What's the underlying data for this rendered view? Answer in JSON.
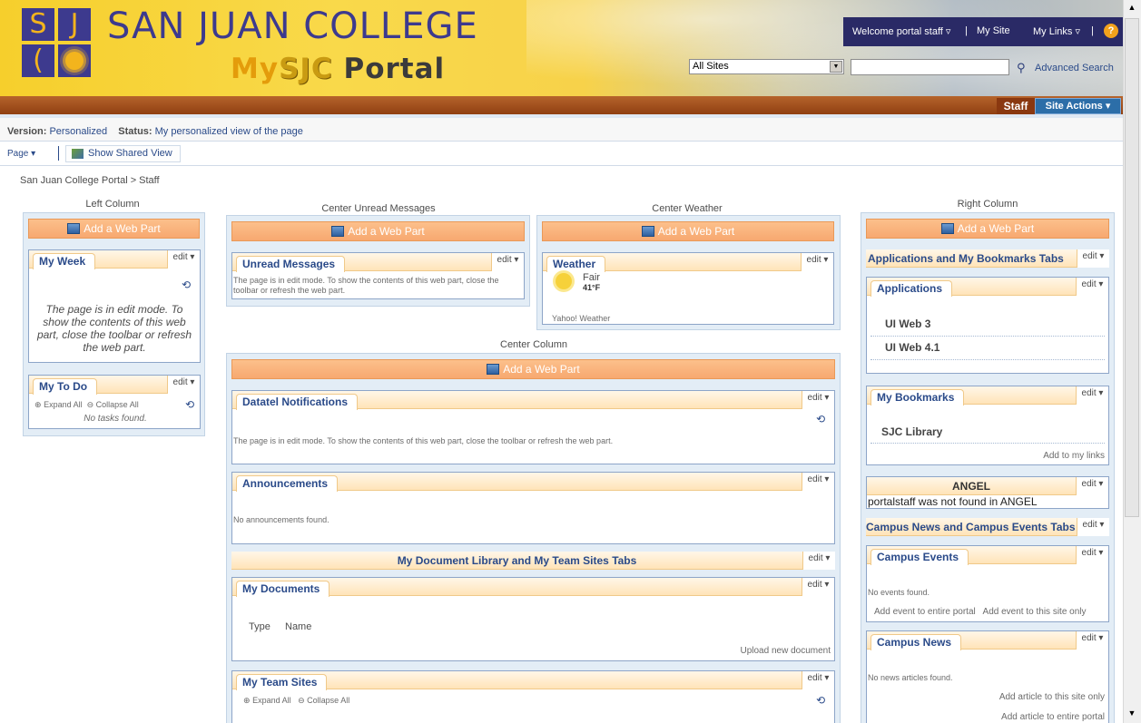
{
  "header": {
    "logo_letters": [
      "S",
      "J",
      "("
    ],
    "college_name": "SAN JUAN COLLEGE",
    "portal_name_my": "My",
    "portal_name_sjc": "SJC",
    "portal_name_portal": "Portal",
    "welcome": "Welcome portal staff ▿",
    "pipe": "|",
    "my_site": "My Site",
    "my_links": "My Links ▿",
    "help": "?",
    "scope_value": "All Sites",
    "scope_arrow": "▼",
    "search_value": "",
    "advanced_search": "Advanced Search",
    "staff_tab": "Staff",
    "site_actions": "Site Actions ▾"
  },
  "version_bar": {
    "version_label": "Version:",
    "version_value": "Personalized",
    "status_label": "Status:",
    "status_value": "My personalized view of the page"
  },
  "toolbar": {
    "page_menu": "Page ▾",
    "shared_view": "Show Shared View"
  },
  "breadcrumb": "San Juan College Portal > Staff",
  "zones": {
    "left": "Left Column",
    "center_unread": "Center Unread Messages",
    "center_weather": "Center Weather",
    "center_column": "Center Column",
    "right": "Right Column"
  },
  "add_web_part": "Add a Web Part",
  "edit_label": "edit ▾",
  "refresh_icon": "⟲",
  "edit_mode_msg": "The page is in edit mode. To show the contents of this web part, close the toolbar or refresh the web part.",
  "left": {
    "my_week": "My Week",
    "my_todo": "My To Do",
    "expand_all": "Expand All",
    "collapse_all": "Collapse All",
    "no_tasks": "No tasks found."
  },
  "unread": {
    "title": "Unread Messages"
  },
  "weather": {
    "title": "Weather",
    "condition": "Fair",
    "temperature": "41°F",
    "source": "Yahoo! Weather",
    "icon": "sun-icon"
  },
  "center": {
    "datatel": "Datatel Notifications",
    "announcements": "Announcements",
    "no_announcements": "No announcements found.",
    "doc_tabs": "My Document Library and My Team Sites Tabs",
    "my_documents": "My Documents",
    "type_col": "Type",
    "name_col": "Name",
    "upload": "Upload new document",
    "my_team_sites": "My Team Sites",
    "expand_all": "Expand All",
    "collapse_all": "Collapse All"
  },
  "right": {
    "apps_tabs": "Applications and My Bookmarks Tabs",
    "applications": "Applications",
    "apps": [
      "UI Web 3",
      "UI Web 4.1"
    ],
    "bookmarks": "My Bookmarks",
    "bookmark_items": [
      "SJC Library"
    ],
    "add_to_links": "Add to my links",
    "angel": "ANGEL",
    "angel_msg": "portalstaff was not found in ANGEL",
    "campus_tabs": "Campus News and Campus Events Tabs",
    "campus_events": "Campus Events",
    "no_events": "No events found.",
    "add_event_portal": "Add event to entire portal",
    "add_event_site": "Add event to this site only",
    "campus_news": "Campus News",
    "no_news": "No news articles found.",
    "add_article_site": "Add article to this site only",
    "add_article_portal": "Add article to entire portal"
  },
  "colors": {
    "brand_purple": "#3d3a8e",
    "brand_gold": "#f3b41d",
    "link_blue": "#2a4a89",
    "add_web_part_orange": "#f7a870"
  }
}
